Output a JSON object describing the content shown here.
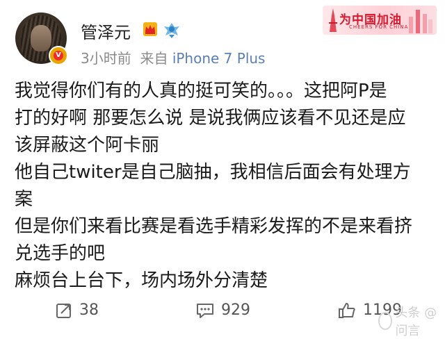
{
  "post": {
    "username": "管泽元",
    "time": "3小时前",
    "source_prefix": "来自",
    "source": "iPhone 7 Plus",
    "badge_text": "为中国加油",
    "badge_sub": "CHEERS FOR CHINA",
    "verified_mark": "V",
    "content_lines": [
      "我觉得你们有的人真的挺可笑的。。。这把阿P是",
      "打的好啊 那要怎么说 是说我俩应该看不见还是应",
      "该屏蔽这个阿卡丽",
      "他自己twiter是自己脑抽，我相信后面会有处理方",
      "案",
      "但是你们来看比赛是看选手精彩发挥的不是来看挤",
      "兑选手的吧",
      "麻烦台上台下，场内场外分清楚"
    ]
  },
  "footer": {
    "repost_count": "38",
    "comment_count": "929",
    "like_count": "1199",
    "watermark": "头条 @问言"
  },
  "colors": {
    "accent_link": "#5a7fb5",
    "verified": "#e8a400",
    "badge_red": "#d6192e"
  }
}
